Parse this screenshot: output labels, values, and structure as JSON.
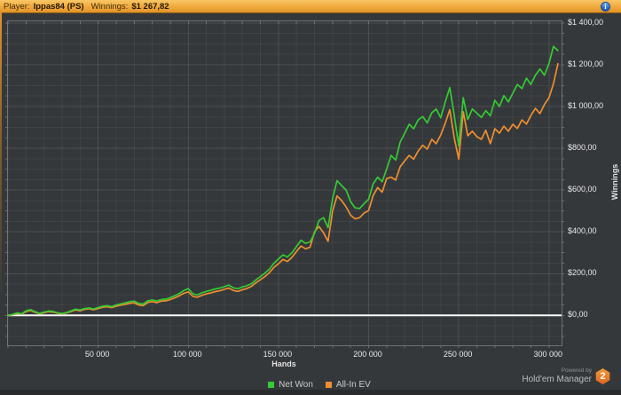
{
  "header": {
    "player_label": "Player:",
    "player_name": "Ippas84 (PS)",
    "winnings_label": "Winnings:",
    "winnings_value": "$1 267,82"
  },
  "colors": {
    "net_won": "#33cc33",
    "all_in_ev": "#ee8f2e",
    "zero_line": "#ffffff",
    "grid_minor": "rgba(255,255,255,0.05)",
    "grid_major": "rgba(255,255,255,0.11)",
    "axis_tick": "#6f7275",
    "top_bar": "#f2ae43",
    "background": "#35383b"
  },
  "chart_data": {
    "type": "line",
    "title": "",
    "xlabel": "Hands",
    "ylabel": "Winnings",
    "legend_position": "bottom",
    "grid": true,
    "x_axis": {
      "min": 0,
      "max": 307000,
      "minor_step": 10000,
      "major_step": 50000,
      "ticks": [
        {
          "value": 50000,
          "label": "50 000"
        },
        {
          "value": 100000,
          "label": "100 000"
        },
        {
          "value": 150000,
          "label": "150 000"
        },
        {
          "value": 200000,
          "label": "200 000"
        },
        {
          "value": 250000,
          "label": "250 000"
        },
        {
          "value": 300000,
          "label": "300 000"
        }
      ]
    },
    "y_axis": {
      "min": -143,
      "max": 1408,
      "minor_step": 50,
      "major_step": 200,
      "ticks": [
        {
          "value": 0,
          "label": "$0,00"
        },
        {
          "value": 200,
          "label": "$200,00"
        },
        {
          "value": 400,
          "label": "$400,00"
        },
        {
          "value": 600,
          "label": "$600,00"
        },
        {
          "value": 800,
          "label": "$800,00"
        },
        {
          "value": 1000,
          "label": "$1 000,00"
        },
        {
          "value": 1200,
          "label": "$1 200,00"
        },
        {
          "value": 1400,
          "label": "$1 400,00"
        }
      ]
    },
    "zero_line": 0,
    "x_start": 0,
    "x_step": 2500,
    "series": [
      {
        "name": "All-In EV",
        "color": "#ee8f2e",
        "values": [
          0,
          3,
          9,
          6,
          18,
          24,
          15,
          8,
          13,
          18,
          16,
          11,
          7,
          12,
          19,
          26,
          22,
          29,
          32,
          27,
          33,
          39,
          42,
          37,
          44,
          49,
          53,
          58,
          60,
          50,
          47,
          62,
          66,
          61,
          68,
          70,
          76,
          84,
          94,
          106,
          113,
          92,
          87,
          96,
          103,
          108,
          114,
          118,
          125,
          131,
          119,
          115,
          123,
          129,
          139,
          156,
          171,
          186,
          205,
          230,
          248,
          268,
          258,
          278,
          306,
          332,
          319,
          326,
          400,
          426,
          396,
          355,
          500,
          572,
          550,
          520,
          480,
          462,
          468,
          490,
          502,
          574,
          612,
          590,
          655,
          662,
          648,
          712,
          740,
          766,
          748,
          787,
          815,
          796,
          843,
          822,
          864,
          920,
          985,
          848,
          748,
          975,
          860,
          882,
          856,
          843,
          886,
          822,
          894,
          872,
          906,
          882,
          915,
          895,
          936,
          916,
          957,
          991,
          966,
          1010,
          1042,
          1110,
          1205
        ]
      },
      {
        "name": "Net Won",
        "color": "#33cc33",
        "values": [
          0,
          5,
          12,
          8,
          22,
          28,
          18,
          10,
          16,
          21,
          19,
          13,
          9,
          14,
          22,
          30,
          26,
          33,
          36,
          31,
          38,
          44,
          47,
          42,
          50,
          55,
          60,
          66,
          68,
          57,
          54,
          70,
          74,
          69,
          76,
          78,
          85,
          94,
          105,
          119,
          128,
          104,
          98,
          108,
          115,
          121,
          127,
          131,
          138,
          145,
          132,
          128,
          136,
          142,
          152,
          170,
          186,
          202,
          222,
          250,
          270,
          290,
          280,
          300,
          330,
          360,
          345,
          352,
          392,
          455,
          468,
          420,
          560,
          645,
          622,
          600,
          545,
          515,
          512,
          535,
          556,
          630,
          662,
          640,
          700,
          766,
          744,
          830,
          872,
          915,
          894,
          936,
          952,
          922,
          970,
          988,
          946,
          1022,
          1090,
          955,
          812,
          1042,
          938,
          988,
          968,
          948,
          980,
          956,
          1030,
          1000,
          1052,
          1022,
          1064,
          1106,
          1086,
          1136,
          1106,
          1150,
          1180,
          1150,
          1206,
          1288,
          1267.82
        ]
      }
    ]
  },
  "legend": {
    "items": [
      {
        "label": "Net Won",
        "color": "#33cc33"
      },
      {
        "label": "All-In EV",
        "color": "#ee8f2e"
      }
    ]
  },
  "footer": {
    "powered_by": "Powered by",
    "brand": "Hold'em Manager",
    "badge": "2"
  }
}
